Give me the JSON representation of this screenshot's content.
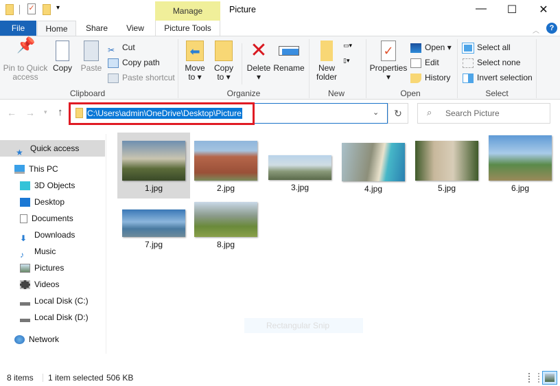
{
  "window": {
    "title": "Picture",
    "context_tab": "Manage",
    "context_group": "Picture Tools"
  },
  "tabs": {
    "file": "File",
    "home": "Home",
    "share": "Share",
    "view": "View",
    "picture_tools": "Picture Tools"
  },
  "ribbon": {
    "clipboard": {
      "label": "Clipboard",
      "pin": "Pin to Quick access",
      "copy": "Copy",
      "paste": "Paste",
      "cut": "Cut",
      "copy_path": "Copy path",
      "paste_shortcut": "Paste shortcut"
    },
    "organize": {
      "label": "Organize",
      "move_to": "Move to",
      "copy_to": "Copy to",
      "delete": "Delete",
      "rename": "Rename"
    },
    "new": {
      "label": "New",
      "new_folder": "New folder"
    },
    "open": {
      "label": "Open",
      "properties": "Properties",
      "open": "Open",
      "edit": "Edit",
      "history": "History"
    },
    "select": {
      "label": "Select",
      "select_all": "Select all",
      "select_none": "Select none",
      "invert": "Invert selection"
    }
  },
  "address": {
    "path": "C:\\Users\\admin\\OneDrive\\Desktop\\Picture",
    "search_placeholder": "Search Picture"
  },
  "nav": {
    "quick_access": "Quick access",
    "this_pc": "This PC",
    "items": [
      "3D Objects",
      "Desktop",
      "Documents",
      "Downloads",
      "Music",
      "Pictures",
      "Videos",
      "Local Disk (C:)",
      "Local Disk (D:)"
    ],
    "network": "Network"
  },
  "files": [
    "1.jpg",
    "2.jpg",
    "3.jpg",
    "4.jpg",
    "5.jpg",
    "6.jpg",
    "7.jpg",
    "8.jpg"
  ],
  "overlay": {
    "snip": "Rectangular Snip"
  },
  "status": {
    "count": "8 items",
    "selected": "1 item selected",
    "size": "506 KB"
  },
  "colors": {
    "accent": "#1964b8",
    "highlight": "#e01b24",
    "manage": "#f0ef9a"
  }
}
